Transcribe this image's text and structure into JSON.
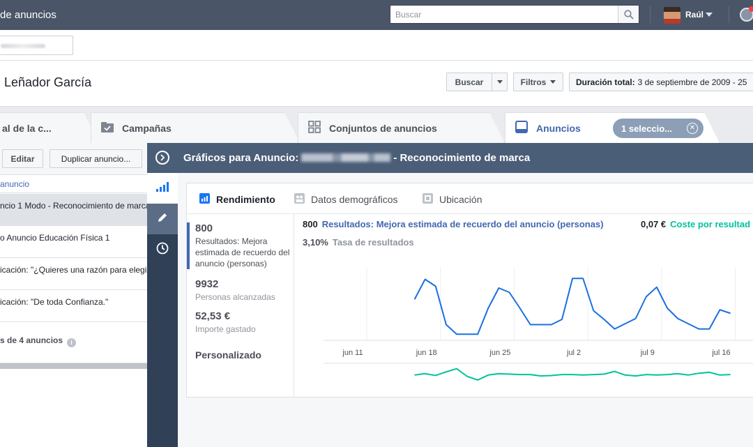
{
  "topbar": {
    "title": "de anuncios",
    "search_placeholder": "Buscar",
    "user_name": "Raúl",
    "icons": [
      "search-icon",
      "chevron-down-icon",
      "globe-icon"
    ]
  },
  "header": {
    "account_name": "Leñador García",
    "search_button": "Buscar",
    "filters_button": "Filtros",
    "date_range_label": "Duración total:",
    "date_range_value": "3 de septiembre de 2009 - 25"
  },
  "tabs": [
    {
      "label": "al de la c...",
      "icon": "account-icon"
    },
    {
      "label": "Campañas",
      "icon": "checkbox-folder-icon"
    },
    {
      "label": "Conjuntos de anuncios",
      "icon": "grid-icon"
    },
    {
      "label": "Anuncios",
      "icon": "ad-screen-icon",
      "active": true
    }
  ],
  "selection_pill": "1 seleccio...",
  "left_panel": {
    "edit_button": "Editar",
    "duplicate_button": "Duplicar anuncio...",
    "column_header": "anuncio",
    "rows": [
      "ncio 1 Modo - Reconocimiento de marca",
      "o Anuncio Educación Física 1",
      "icación: \"¿Quieres una razón para elegir",
      "icación: \"De toda Confianza.\""
    ],
    "summary": "s de 4 anuncios"
  },
  "flyout": {
    "title_prefix": "Gráficos para Anuncio:",
    "title_suffix": "- Reconocimiento de marca",
    "rail_icons": [
      "bar-chart-icon",
      "pencil-icon",
      "clock-icon"
    ]
  },
  "chart_tabs": [
    {
      "label": "Rendimiento",
      "icon": "bar-chart-icon",
      "active": true
    },
    {
      "label": "Datos demográficos",
      "icon": "people-icon"
    },
    {
      "label": "Ubicación",
      "icon": "placement-icon"
    }
  ],
  "metrics": [
    {
      "value": "800",
      "label": "Resultados: Mejora estimada de recuerdo del anuncio (personas)"
    },
    {
      "value": "9932",
      "label": "Personas alcanzadas"
    },
    {
      "value": "52,53 €",
      "label": "Importe gastado"
    }
  ],
  "custom_label": "Personalizado",
  "legend": {
    "results_value": "800",
    "results_label": "Resultados: Mejora estimada de recuerdo del anuncio (personas)",
    "cost_value": "0,07 €",
    "cost_label": "Coste por resultad",
    "rate_value": "3,10%",
    "rate_label": "Tasa de resultados"
  },
  "colors": {
    "topbar": "#4b5568",
    "flyout_header": "#4b5e77",
    "rail": "#2f4057",
    "results_line": "#1a6fe0",
    "cost_line": "#00c39a"
  },
  "chart_data": {
    "type": "line",
    "x_tick_labels": [
      "jun 11",
      "jun 18",
      "jun 25",
      "jul 2",
      "jul 9",
      "jul 16"
    ],
    "x_tick_days": [
      0,
      7,
      14,
      21,
      28,
      35
    ],
    "series": [
      {
        "key": "results",
        "color": "#1a6fe0",
        "points": [
          [
            6,
            47
          ],
          [
            7,
            70
          ],
          [
            8,
            62
          ],
          [
            9,
            18
          ],
          [
            10,
            7
          ],
          [
            11,
            7
          ],
          [
            12,
            7
          ],
          [
            13,
            37
          ],
          [
            14,
            60
          ],
          [
            15,
            55
          ],
          [
            16,
            37
          ],
          [
            17,
            18
          ],
          [
            18,
            18
          ],
          [
            19,
            18
          ],
          [
            20,
            24
          ],
          [
            21,
            71
          ],
          [
            22,
            71
          ],
          [
            23,
            34
          ],
          [
            24,
            24
          ],
          [
            25,
            13
          ],
          [
            26,
            19
          ],
          [
            27,
            25
          ],
          [
            28,
            50
          ],
          [
            29,
            61
          ],
          [
            30,
            37
          ],
          [
            31,
            25
          ],
          [
            32,
            19
          ],
          [
            33,
            13
          ],
          [
            34,
            13
          ],
          [
            35,
            35
          ],
          [
            36,
            31
          ]
        ]
      },
      {
        "key": "cost",
        "color": "#00c39a",
        "points": [
          [
            6,
            48
          ],
          [
            7,
            51
          ],
          [
            8,
            47
          ],
          [
            9,
            55
          ],
          [
            10,
            62
          ],
          [
            11,
            45
          ],
          [
            12,
            37
          ],
          [
            13,
            48
          ],
          [
            14,
            51
          ],
          [
            15,
            50
          ],
          [
            16,
            49
          ],
          [
            17,
            49
          ],
          [
            18,
            46
          ],
          [
            19,
            47
          ],
          [
            20,
            49
          ],
          [
            21,
            49
          ],
          [
            22,
            48
          ],
          [
            23,
            49
          ],
          [
            24,
            50
          ],
          [
            25,
            56
          ],
          [
            26,
            48
          ],
          [
            27,
            46
          ],
          [
            28,
            49
          ],
          [
            29,
            48
          ],
          [
            30,
            49
          ],
          [
            31,
            51
          ],
          [
            32,
            48
          ],
          [
            33,
            52
          ],
          [
            34,
            54
          ],
          [
            35,
            48
          ],
          [
            36,
            49
          ]
        ]
      }
    ],
    "grid": true
  }
}
